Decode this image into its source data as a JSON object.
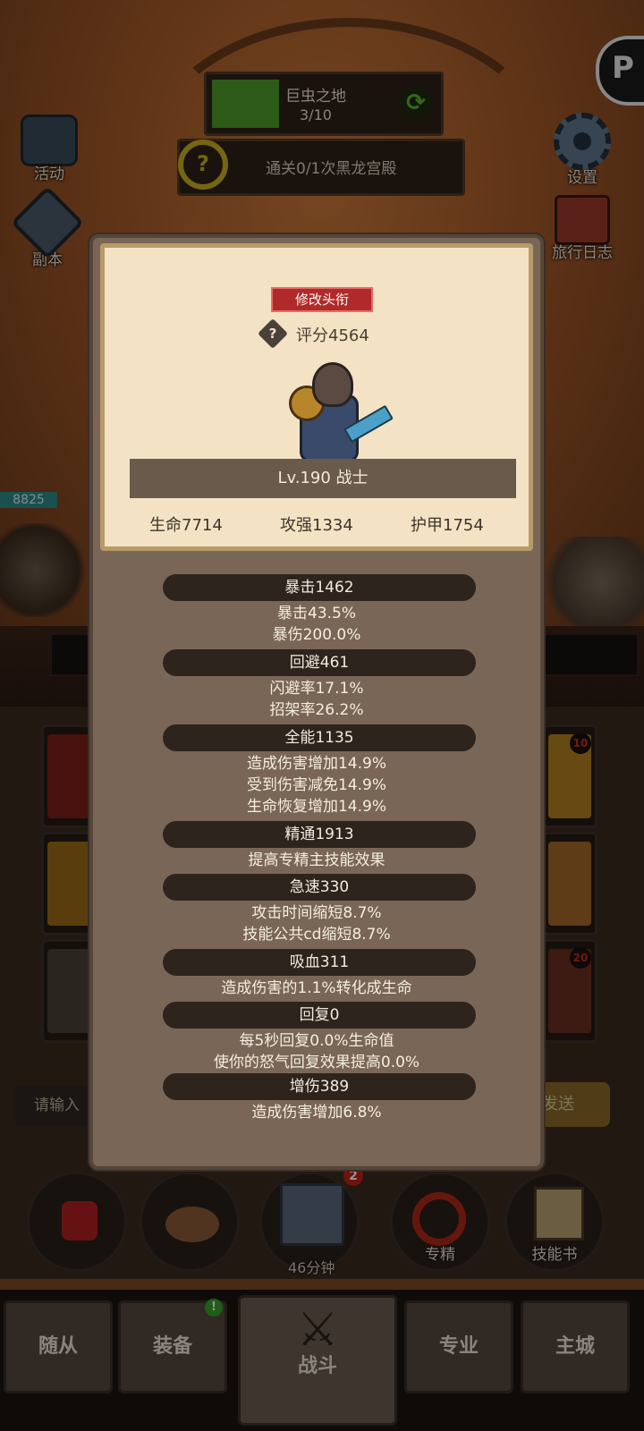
{
  "hud": {
    "stage_name": "巨虫之地",
    "stage_count": "3/10",
    "quest_text": "通关0/1次黑龙宫殿",
    "side_left": [
      "活动",
      "副本"
    ],
    "side_right": [
      "设置",
      "旅行日志"
    ],
    "hp_value": "8825",
    "chat_placeholder": "请输入",
    "send_label": "发送",
    "actions": [
      "专精",
      "技能书"
    ],
    "timer": "46分钟",
    "badge_count": "2",
    "equip_notice": "!"
  },
  "nav": {
    "tabs": [
      "随从",
      "装备",
      "战斗",
      "专业",
      "主城"
    ],
    "active": "战斗"
  },
  "profile": {
    "title_button": "修改头衔",
    "score": "评分4564",
    "level_class": "Lv.190 战士",
    "hp": "生命7714",
    "attack": "攻强1334",
    "armor": "护甲1754"
  },
  "stats": [
    {
      "header": "暴击1462",
      "lines": [
        "暴击43.5%",
        "暴伤200.0%"
      ]
    },
    {
      "header": "回避461",
      "lines": [
        "闪避率17.1%",
        "招架率26.2%"
      ]
    },
    {
      "header": "全能1135",
      "lines": [
        "造成伤害增加14.9%",
        "受到伤害减免14.9%",
        "生命恢复增加14.9%"
      ]
    },
    {
      "header": "精通1913",
      "lines": [
        "提高专精主技能效果"
      ]
    },
    {
      "header": "急速330",
      "lines": [
        "攻击时间缩短8.7%",
        "技能公共cd缩短8.7%"
      ]
    },
    {
      "header": "吸血311",
      "lines": [
        "造成伤害的1.1%转化成生命"
      ]
    },
    {
      "header": "回复0",
      "lines": [
        "每5秒回复0.0%生命值",
        "使你的怒气回复效果提高0.0%"
      ]
    },
    {
      "header": "增伤389",
      "lines": [
        "造成伤害增加6.8%"
      ]
    }
  ],
  "slot_badges": [
    "10",
    "20"
  ],
  "colors": {
    "title_button": "#b02a2a",
    "stage_progress": "#4f9a2c",
    "parchment": "#f3e3c4",
    "modal_bg": "#7a6656",
    "stat_pill": "#2e241e"
  },
  "stage_progress_fraction": 0.3
}
